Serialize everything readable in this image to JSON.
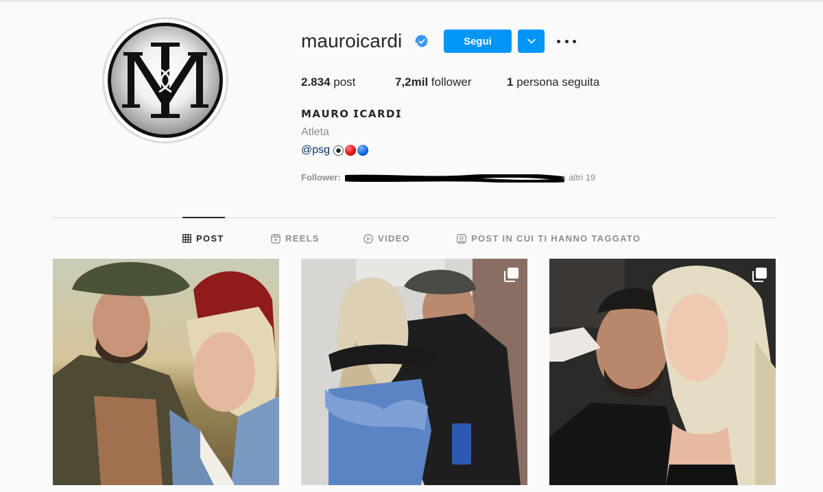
{
  "profile": {
    "username": "mauroicardi",
    "follow_label": "Segui",
    "stats": {
      "posts_count": "2.834",
      "posts_label": " post",
      "followers_count": "7,2mil",
      "followers_label": " follower",
      "following_count": "1",
      "following_label": " persona seguita"
    },
    "full_name": "𝗠𝗔𝗨𝗥𝗢 𝗜𝗖𝗔𝗥𝗗𝗜",
    "category": "Atleta",
    "bio_link": "@psg",
    "followed_by_label": "Follower:",
    "followed_by_others": "+ altri 19"
  },
  "tabs": [
    {
      "label": "POST",
      "icon": "grid-icon",
      "active": true
    },
    {
      "label": "REELS",
      "icon": "reels-icon",
      "active": false
    },
    {
      "label": "VIDEO",
      "icon": "video-icon",
      "active": false
    },
    {
      "label": "POST IN CUI TI HANNO TAGGATO",
      "icon": "tagged-icon",
      "active": false
    }
  ],
  "posts": [
    {
      "type": "photo",
      "multiple": false
    },
    {
      "type": "photo",
      "multiple": true
    },
    {
      "type": "photo",
      "multiple": true
    }
  ],
  "colors": {
    "accent": "#0095f6",
    "link": "#00376b",
    "muted": "#8e8e8e",
    "text": "#262626",
    "background": "#fafafa"
  }
}
